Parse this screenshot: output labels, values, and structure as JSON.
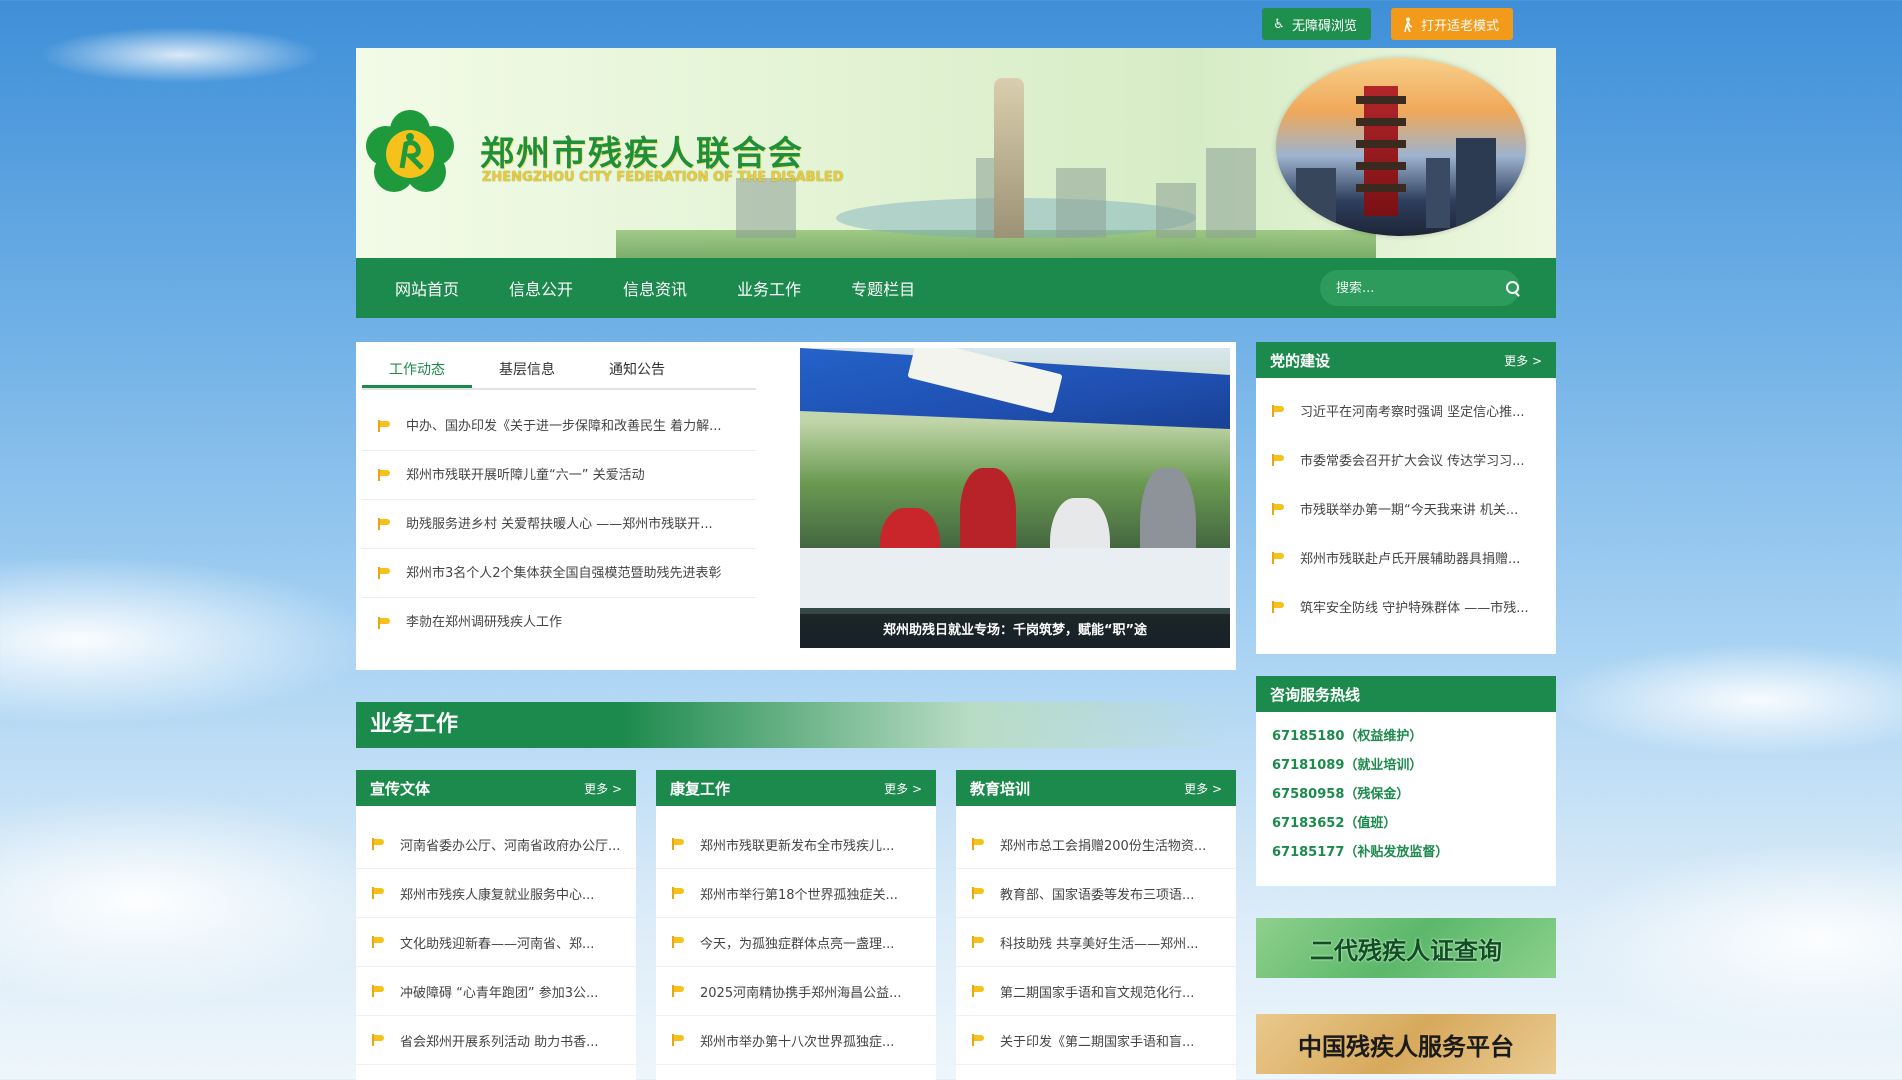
{
  "topbar": {
    "accessible_label": "无障碍浏览",
    "elderly_label": "打开适老模式",
    "accessible_icon": "wheelchair-icon",
    "elderly_icon": "elderly-person-icon"
  },
  "header": {
    "title": "郑州市残疾人联合会",
    "subtitle": "ZHENGZHOU CITY FEDERATION OF THE DISABLED"
  },
  "nav": {
    "items": [
      "网站首页",
      "信息公开",
      "信息资讯",
      "业务工作",
      "专题栏目"
    ],
    "search_placeholder": "搜索..."
  },
  "news": {
    "tabs": [
      "工作动态",
      "基层信息",
      "通知公告"
    ],
    "items": [
      "中办、国办印发《关于进一步保障和改善民生 着力解...",
      "郑州市残联开展听障儿童“六一” 关爱活动",
      "助残服务进乡村 关爱帮扶暖人心 ——郑州市残联开...",
      "郑州市3名个人2个集体获全国自强模范暨助残先进表彰",
      "李勍在郑州调研残疾人工作"
    ],
    "photo_caption": "郑州助残日就业专场：千岗筑梦，赋能“职”途"
  },
  "party": {
    "title": "党的建设",
    "more": "更多 >",
    "items": [
      "习近平在河南考察时强调 坚定信心推...",
      "市委常委会召开扩大会议 传达学习习...",
      "市残联举办第一期“今天我来讲 机关...",
      "郑州市残联赴卢氏开展辅助器具捐赠...",
      "筑牢安全防线 守护特殊群体 ——市残..."
    ]
  },
  "hotline": {
    "title": "咨询服务热线",
    "items": [
      "67185180（权益维护）",
      "67181089（就业培训）",
      "67580958（残保金）",
      "67183652（值班）",
      "67185177（补贴发放监督）"
    ]
  },
  "business": {
    "title": "业务工作",
    "columns": [
      {
        "title": "宣传文体",
        "more": "更多 >",
        "items": [
          "河南省委办公厅、河南省政府办公厅...",
          "郑州市残疾人康复就业服务中心...",
          "文化助残迎新春——河南省、郑...",
          "冲破障碍 “心青年跑团” 参加3公...",
          "省会郑州开展系列活动 助力书香..."
        ]
      },
      {
        "title": "康复工作",
        "more": "更多 >",
        "items": [
          "郑州市残联更新发布全市残疾儿...",
          "郑州市举行第18个世界孤独症关...",
          "今天，为孤独症群体点亮一盏理...",
          "2025河南精协携手郑州海昌公益...",
          "郑州市举办第十八次世界孤独症..."
        ]
      },
      {
        "title": "教育培训",
        "more": "更多 >",
        "items": [
          "郑州市总工会捐赠200份生活物资...",
          "教育部、国家语委等发布三项语...",
          "科技助残 共享美好生活——郑州...",
          "第二期国家手语和盲文规范化行...",
          "关于印发《第二期国家手语和盲..."
        ]
      }
    ]
  },
  "links": {
    "card_query": "二代残疾人证查询",
    "service_platform": "中国残疾人服务平台"
  },
  "colors": {
    "brand_green": "#1c8a4c",
    "accent_orange": "#f29a1a",
    "flag_yellow": "#f4c21b"
  }
}
